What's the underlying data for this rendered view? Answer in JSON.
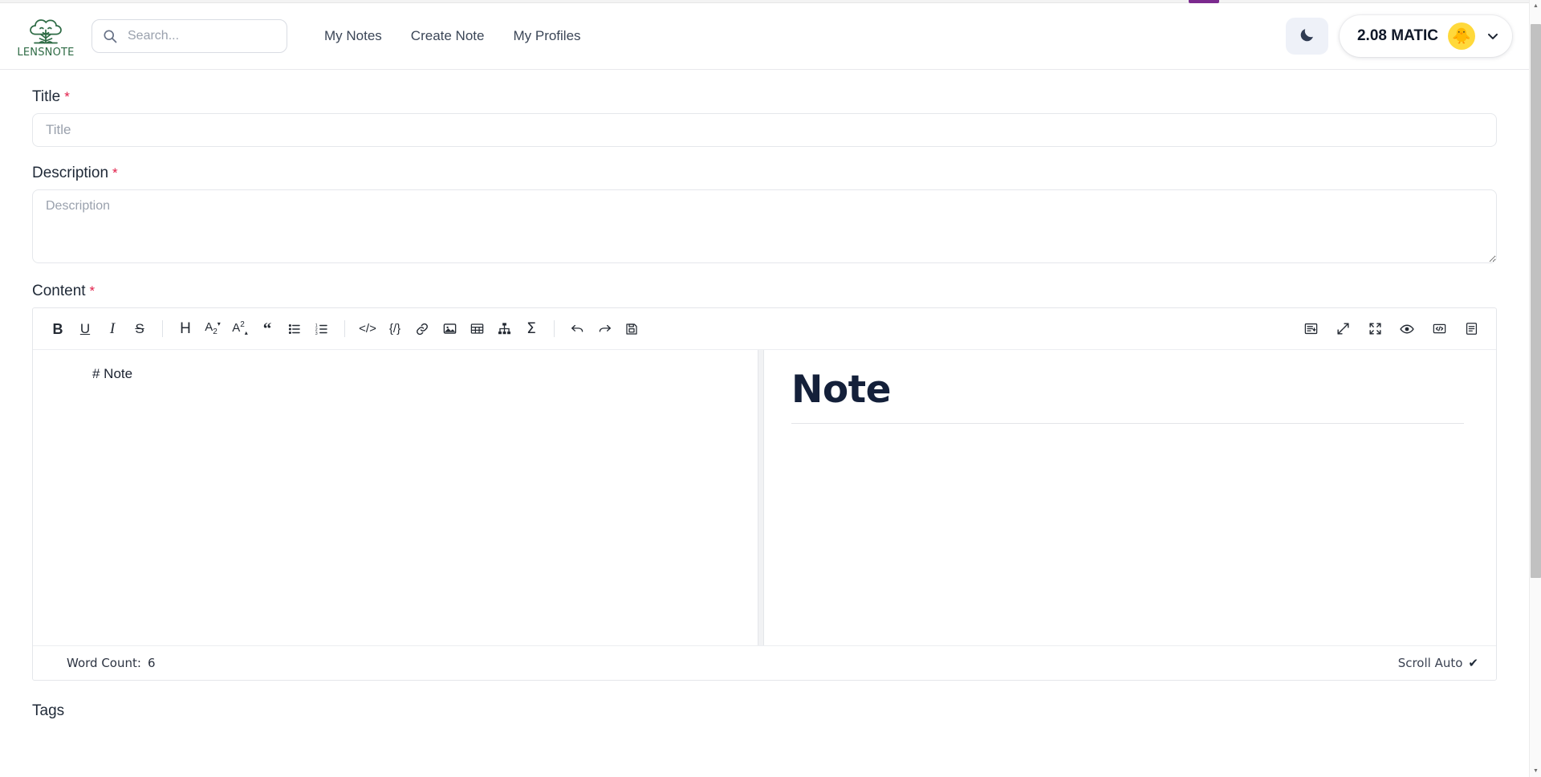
{
  "brand": {
    "name": "LENSNOTE",
    "logo_icon": "tree-face-logo"
  },
  "search": {
    "placeholder": "Search...",
    "value": "",
    "icon": "search-icon"
  },
  "nav": {
    "links": [
      {
        "label": "My Notes"
      },
      {
        "label": "Create Note"
      },
      {
        "label": "My Profiles"
      }
    ]
  },
  "account": {
    "theme_toggle_icon": "moon-icon",
    "balance": "2.08 MATIC",
    "avatar_emoji": "🐥",
    "chevron_icon": "chevron-down-icon"
  },
  "form": {
    "title": {
      "label": "Title",
      "required_marker": "*",
      "placeholder": "Title",
      "value": ""
    },
    "description": {
      "label": "Description",
      "required_marker": "*",
      "placeholder": "Description",
      "value": ""
    },
    "content": {
      "label": "Content",
      "required_marker": "*"
    },
    "tags": {
      "label": "Tags"
    }
  },
  "editor": {
    "toolbar_left": [
      {
        "name": "bold-icon",
        "glyph": "B",
        "style": "bold"
      },
      {
        "name": "underline-icon",
        "glyph": "U",
        "style": "underline"
      },
      {
        "name": "italic-icon",
        "glyph": "I",
        "style": "italic"
      },
      {
        "name": "strikethrough-icon",
        "glyph": "S",
        "style": "strike"
      },
      {
        "name": "separator",
        "glyph": "",
        "style": "sep"
      },
      {
        "name": "heading-icon",
        "glyph": "H",
        "style": "plain"
      },
      {
        "name": "subscript-icon",
        "glyph": "A₂",
        "style": "small"
      },
      {
        "name": "superscript-icon",
        "glyph": "A²",
        "style": "small"
      },
      {
        "name": "blockquote-icon",
        "glyph": "❝",
        "style": "plain"
      },
      {
        "name": "unordered-list-icon",
        "glyph": "☰",
        "style": "svg-ul"
      },
      {
        "name": "ordered-list-icon",
        "glyph": "",
        "style": "svg-ol"
      },
      {
        "name": "separator",
        "glyph": "",
        "style": "sep"
      },
      {
        "name": "inline-code-icon",
        "glyph": "</>",
        "style": "code"
      },
      {
        "name": "code-block-icon",
        "glyph": "{/}",
        "style": "code"
      },
      {
        "name": "link-icon",
        "glyph": "",
        "style": "svg-link"
      },
      {
        "name": "image-icon",
        "glyph": "",
        "style": "svg-image"
      },
      {
        "name": "table-icon",
        "glyph": "",
        "style": "svg-table"
      },
      {
        "name": "diagram-icon",
        "glyph": "",
        "style": "svg-diagram"
      },
      {
        "name": "formula-sigma-icon",
        "glyph": "Σ",
        "style": "plain"
      },
      {
        "name": "separator",
        "glyph": "",
        "style": "sep"
      },
      {
        "name": "undo-icon",
        "glyph": "",
        "style": "svg-undo"
      },
      {
        "name": "redo-icon",
        "glyph": "",
        "style": "svg-redo"
      },
      {
        "name": "save-icon",
        "glyph": "",
        "style": "svg-save"
      }
    ],
    "toolbar_right": [
      {
        "name": "toggle-preview-pane-icon"
      },
      {
        "name": "expand-icon"
      },
      {
        "name": "fullscreen-icon"
      },
      {
        "name": "preview-eye-icon"
      },
      {
        "name": "html-source-icon"
      },
      {
        "name": "outline-panel-icon"
      }
    ],
    "source_text": "# Note",
    "preview_heading": "Note",
    "footer": {
      "word_count_label": "Word Count:",
      "word_count_value": "6",
      "scroll_label": "Scroll Auto",
      "scroll_checked_mark": "✔"
    }
  },
  "colors": {
    "brand_green": "#2e6b45",
    "accent_yellow": "#ffd93b",
    "required_red": "#e11d48",
    "border": "#e5e7eb",
    "text_dark": "#14203a"
  }
}
